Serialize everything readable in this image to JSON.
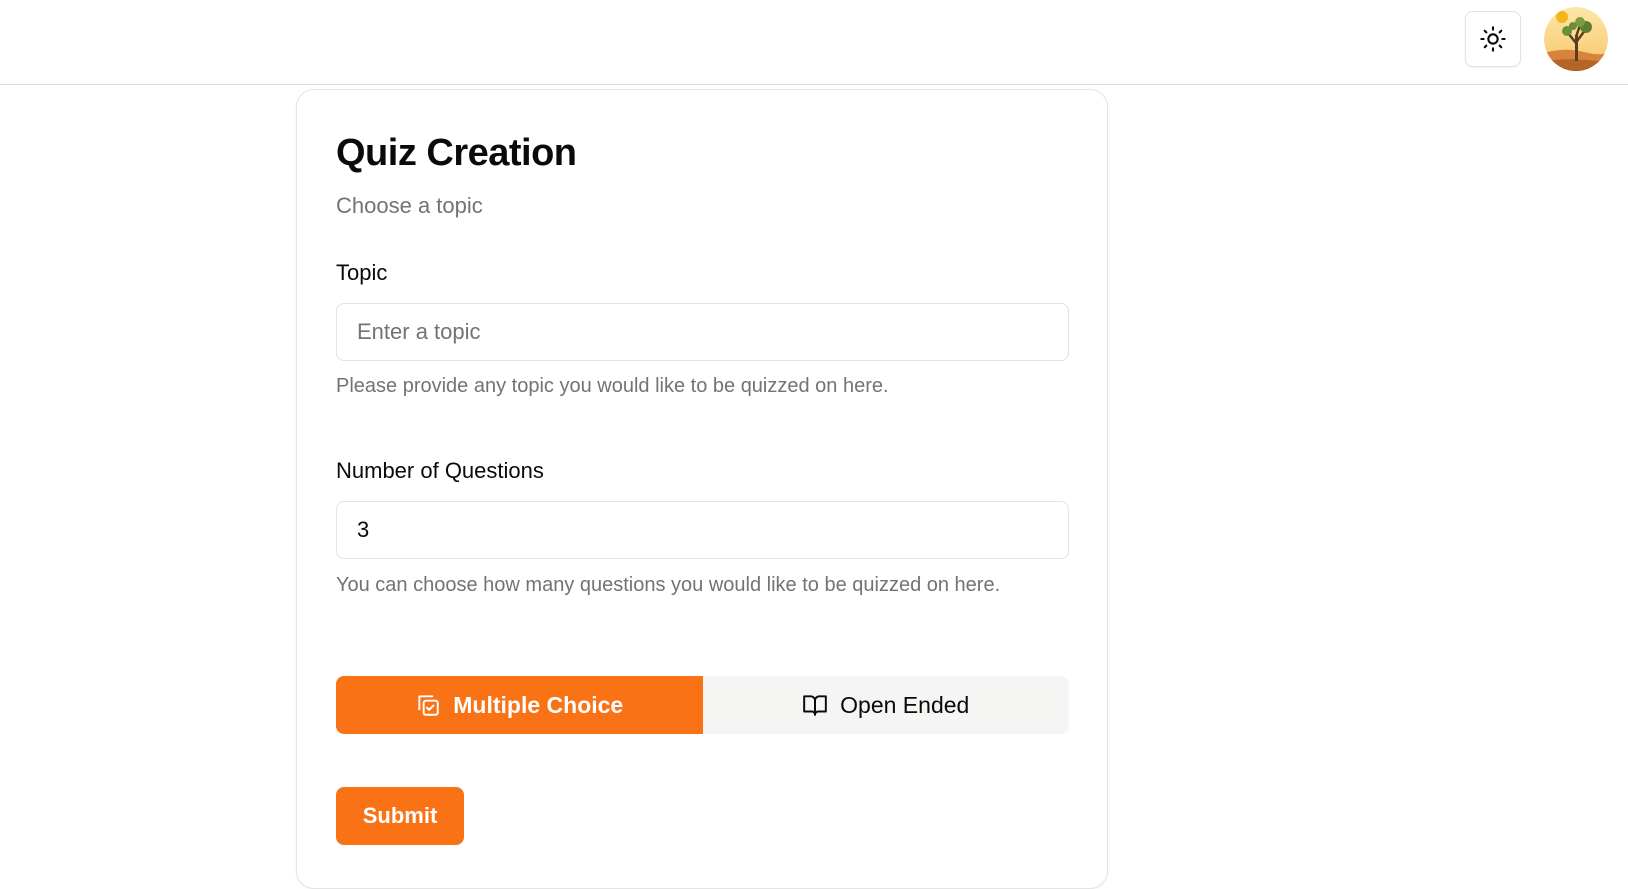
{
  "header": {
    "theme_toggle_icon": "sun-icon",
    "avatar_icon": "joshua-tree-avatar"
  },
  "form": {
    "title": "Quiz Creation",
    "subtitle": "Choose a topic",
    "topic": {
      "label": "Topic",
      "value": "",
      "placeholder": "Enter a topic",
      "help": "Please provide any topic you would like to be quizzed on here."
    },
    "questions": {
      "label": "Number of Questions",
      "value": "3",
      "help": "You can choose how many questions you would like to be quizzed on here."
    },
    "type_toggle": {
      "selected": "Multiple Choice",
      "options": [
        {
          "label": "Multiple Choice",
          "icon": "copy-check-icon"
        },
        {
          "label": "Open Ended",
          "icon": "book-open-icon"
        }
      ]
    },
    "submit_label": "Submit"
  },
  "colors": {
    "accent": "#f97316",
    "muted_text": "#737373",
    "border": "#e2e2e2",
    "toggle_inactive_bg": "#f5f5f4"
  }
}
